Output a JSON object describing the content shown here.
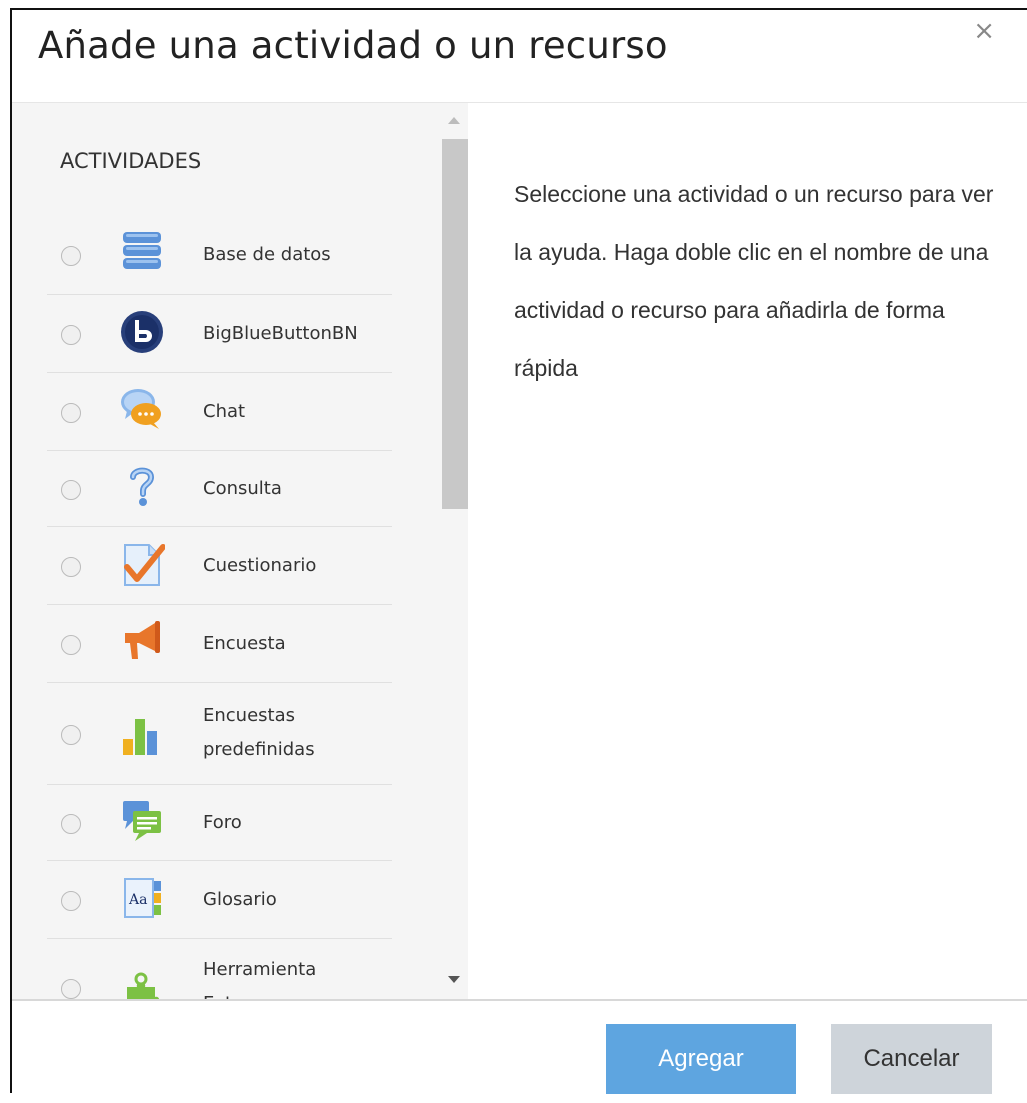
{
  "dialog": {
    "title": "Añade una actividad o un recurso",
    "close_symbol": "×"
  },
  "list": {
    "section_title": "ACTIVIDADES",
    "items": [
      {
        "label": "Base de datos",
        "icon": "database-icon"
      },
      {
        "label": "BigBlueButtonBN",
        "icon": "bigbluebutton-icon"
      },
      {
        "label": "Chat",
        "icon": "chat-icon"
      },
      {
        "label": "Consulta",
        "icon": "question-icon"
      },
      {
        "label": "Cuestionario",
        "icon": "quiz-icon"
      },
      {
        "label": "Encuesta",
        "icon": "megaphone-icon"
      },
      {
        "label": "Encuestas predefinidas",
        "icon": "bar-chart-icon"
      },
      {
        "label": "Foro",
        "icon": "forum-icon"
      },
      {
        "label": "Glosario",
        "icon": "glossary-icon"
      },
      {
        "label": "Herramienta Externa",
        "icon": "puzzle-icon"
      }
    ]
  },
  "help": {
    "text": "Seleccione una actividad o un recurso para ver la ayuda. Haga doble clic en el nombre de una actividad o recurso para añadirla de forma rápida"
  },
  "footer": {
    "add_label": "Agregar",
    "cancel_label": "Cancelar"
  },
  "colors": {
    "primary": "#5ea5e0",
    "secondary": "#ced4da",
    "panel": "#f5f5f5"
  }
}
